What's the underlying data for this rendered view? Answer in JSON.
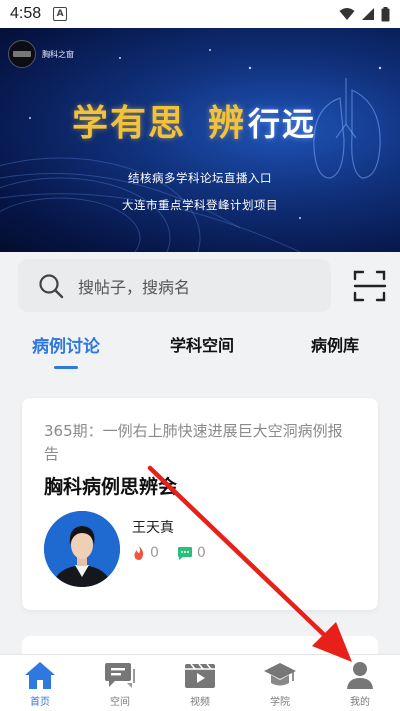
{
  "status_bar": {
    "time": "4:58",
    "notification_letter": "A"
  },
  "banner": {
    "logo_text": "胸科之窗",
    "title_part1": "学有思",
    "title_part2": "辨",
    "title_part3": "行远",
    "subtitle1": "结核病多学科论坛直播入口",
    "subtitle2": "大连市重点学科登峰计划项目"
  },
  "search": {
    "placeholder": "搜帖子，搜病名"
  },
  "tabs": [
    {
      "label": "病例讨论",
      "active": true
    },
    {
      "label": "学科空间",
      "active": false
    },
    {
      "label": "病例库",
      "active": false
    }
  ],
  "post": {
    "subtitle": "365期：一例右上肺快速进展巨大空洞病例报告",
    "title": "胸科病例思辨会",
    "author": "王天真",
    "likes": "0",
    "comments": "0"
  },
  "nav": [
    {
      "label": "首页",
      "icon": "home-icon",
      "active": true
    },
    {
      "label": "空间",
      "icon": "chat-icon",
      "active": false
    },
    {
      "label": "视频",
      "icon": "video-icon",
      "active": false
    },
    {
      "label": "学院",
      "icon": "graduation-cap-icon",
      "active": false
    },
    {
      "label": "我的",
      "icon": "user-icon",
      "active": false
    }
  ],
  "colors": {
    "accent": "#2f78e0",
    "annotation_arrow": "#e8201a",
    "banner_gold": "#f2c23a"
  }
}
